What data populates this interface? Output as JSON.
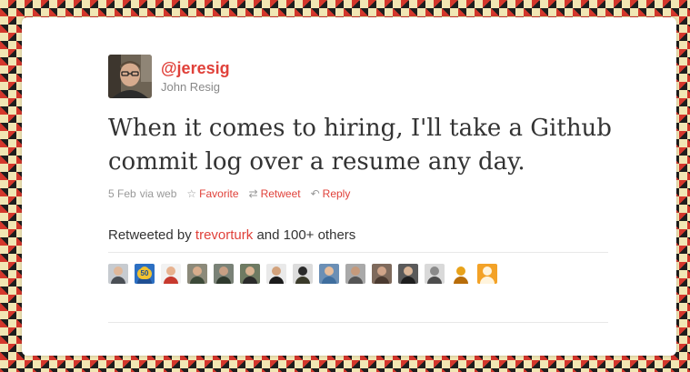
{
  "theme": {
    "link_color": "#e0413a"
  },
  "author": {
    "handle": "@jeresig",
    "name": "John Resig"
  },
  "tweet": {
    "text": "When it comes to hiring, I'll take a Github commit log over a resume any day.",
    "date": "5 Feb",
    "via": "via web"
  },
  "actions": [
    {
      "icon": "star-icon",
      "label": "Favorite"
    },
    {
      "icon": "retweet-icon",
      "label": "Retweet"
    },
    {
      "icon": "reply-icon",
      "label": "Reply"
    }
  ],
  "retweets": {
    "prefix": "Retweeted by",
    "user": "trevorturk",
    "suffix": "and 100+ others",
    "avatars": [
      {
        "name": "retweeter-1",
        "bg": "#c7cbd0",
        "head": "#e0b89a",
        "body": "#4a4f55"
      },
      {
        "name": "retweeter-2",
        "bg": "#2c6fc2",
        "head": "#f2c230",
        "body": "#1f4f93",
        "badge": "50"
      },
      {
        "name": "retweeter-3",
        "bg": "#f2f2f2",
        "head": "#e7b28f",
        "body": "#c73a2e"
      },
      {
        "name": "retweeter-4",
        "bg": "#8c8a7a",
        "head": "#d8ad8c",
        "body": "#3d4a39"
      },
      {
        "name": "retweeter-5",
        "bg": "#7a8277",
        "head": "#c79f84",
        "body": "#2f3a2e"
      },
      {
        "name": "retweeter-6",
        "bg": "#6e7a62",
        "head": "#d8b291",
        "body": "#2a2a2a"
      },
      {
        "name": "retweeter-7",
        "bg": "#e9e9e9",
        "head": "#d2a27c",
        "body": "#1c1c1c"
      },
      {
        "name": "retweeter-8",
        "bg": "#dcdcdc",
        "head": "#2b2b2b",
        "body": "#3a3a2a"
      },
      {
        "name": "retweeter-9",
        "bg": "#6b8fb5",
        "head": "#e6bd9b",
        "body": "#3f6e9e"
      },
      {
        "name": "retweeter-10",
        "bg": "#a9a9a9",
        "head": "#c59a7c",
        "body": "#555555"
      },
      {
        "name": "retweeter-11",
        "bg": "#7e6a5c",
        "head": "#cfa489",
        "body": "#4a3a30"
      },
      {
        "name": "retweeter-12",
        "bg": "#5a5a5a",
        "head": "#d9b597",
        "body": "#1e1e1e"
      },
      {
        "name": "retweeter-13",
        "bg": "#d9d9d9",
        "head": "#8a8a8a",
        "body": "#4d4d4d"
      },
      {
        "name": "retweeter-14",
        "bg": "#ffffff",
        "head": "#e8a21a",
        "body": "#b86d0a"
      },
      {
        "name": "retweeter-15",
        "bg": "#f3a227",
        "head": "#fff4dd",
        "body": "#fff4dd"
      }
    ]
  }
}
